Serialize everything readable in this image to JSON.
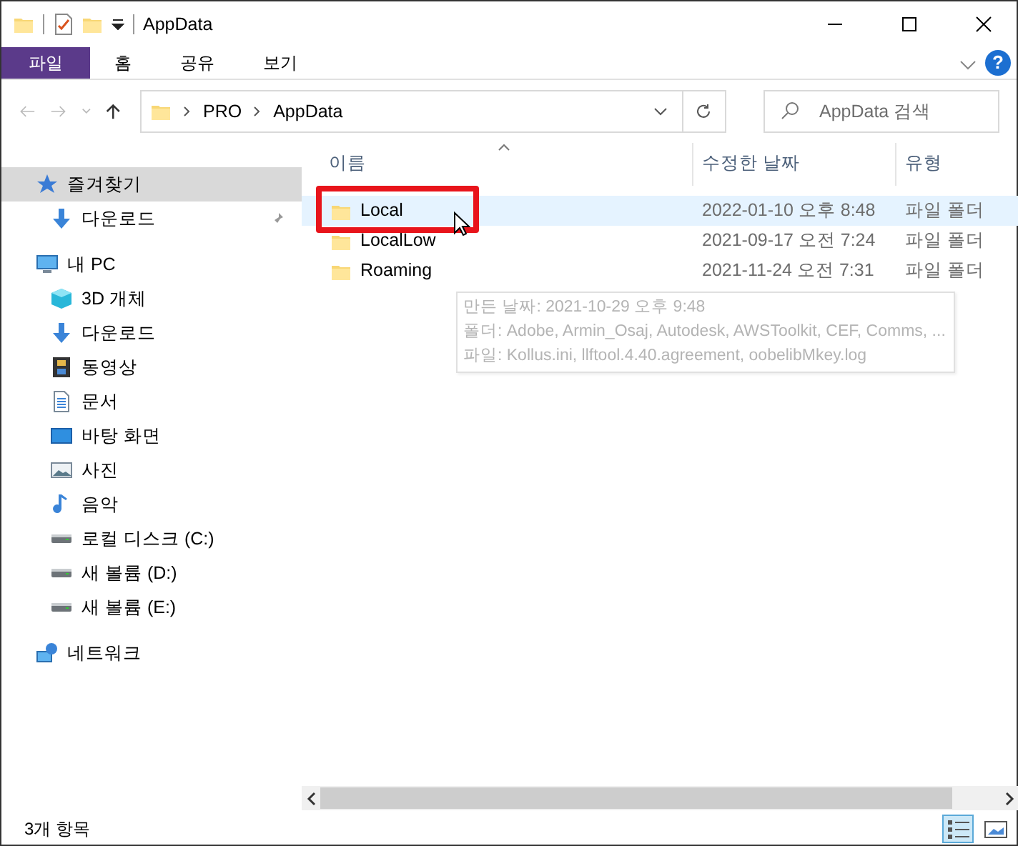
{
  "window": {
    "title": "AppData"
  },
  "ribbon_tabs": [
    {
      "label": "파일",
      "selected": true
    },
    {
      "label": "홈",
      "selected": false
    },
    {
      "label": "공유",
      "selected": false
    },
    {
      "label": "보기",
      "selected": false
    }
  ],
  "help_label": "?",
  "address": {
    "path": [
      "PRO",
      "AppData"
    ]
  },
  "search": {
    "placeholder": "AppData 검색"
  },
  "sidebar": {
    "items": [
      {
        "label": "즐겨찾기",
        "kind": "star",
        "selected": true,
        "children": [
          {
            "label": "다운로드",
            "kind": "download",
            "selected": false,
            "pinned": true
          }
        ]
      },
      {
        "label": "내 PC",
        "kind": "pc",
        "selected": false,
        "children": [
          {
            "label": "3D 개체",
            "kind": "cube",
            "selected": false
          },
          {
            "label": "다운로드",
            "kind": "download",
            "selected": false
          },
          {
            "label": "동영상",
            "kind": "film",
            "selected": false
          },
          {
            "label": "문서",
            "kind": "document",
            "selected": false
          },
          {
            "label": "바탕 화면",
            "kind": "desktop",
            "selected": false
          },
          {
            "label": "사진",
            "kind": "photo",
            "selected": false
          },
          {
            "label": "음악",
            "kind": "music",
            "selected": false
          },
          {
            "label": "로컬 디스크 (C:)",
            "kind": "drive",
            "selected": false
          },
          {
            "label": "새 볼륨 (D:)",
            "kind": "drive",
            "selected": false
          },
          {
            "label": "새 볼륨 (E:)",
            "kind": "drive",
            "selected": false
          }
        ]
      },
      {
        "label": "네트워크",
        "kind": "network",
        "selected": false
      }
    ]
  },
  "columns": [
    {
      "label": "이름",
      "sorted": true
    },
    {
      "label": "수정한 날짜",
      "sorted": false
    },
    {
      "label": "유형",
      "sorted": false
    }
  ],
  "rows": [
    {
      "name": "Local",
      "modified": "2022-01-10 오후 8:48",
      "type": "파일 폴더",
      "hovered": true,
      "marked": true
    },
    {
      "name": "LocalLow",
      "modified": "2021-09-17 오전 7:24",
      "type": "파일 폴더",
      "hovered": false,
      "marked": false
    },
    {
      "name": "Roaming",
      "modified": "2021-11-24 오전 7:31",
      "type": "파일 폴더",
      "hovered": false,
      "marked": false
    }
  ],
  "tooltip": {
    "lines": [
      "만든 날짜: 2021-10-29 오후 9:48",
      "폴더: Adobe, Armin_Osaj, Autodesk, AWSToolkit, CEF, Comms, ...",
      "파일: Kollus.ini, llftool.4.40.agreement, oobelibMkey.log"
    ]
  },
  "status_bar": {
    "count": "3개 항목"
  },
  "views": [
    {
      "kind": "details",
      "selected": true
    },
    {
      "kind": "large",
      "selected": false
    }
  ]
}
